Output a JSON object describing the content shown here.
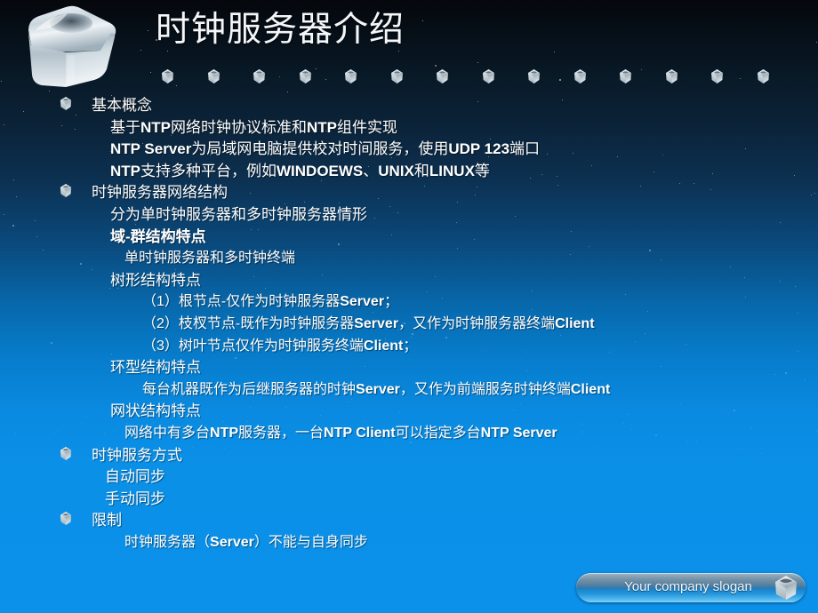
{
  "slide": {
    "title": "时钟服务器介绍",
    "logo_icon": "metallic-cube-icon",
    "decor_cube_count": 14
  },
  "footer": {
    "slogan": "Your company slogan",
    "cube_icon": "cube-icon"
  },
  "colors": {
    "bg_top": "#05070c",
    "bg_mid": "#0a4a7d",
    "bg_bottom": "#0b91ea",
    "text": "#ffffff",
    "pill_accent": "#2597dd"
  },
  "outline": [
    {
      "bullet": true,
      "level": 0,
      "segments": [
        {
          "t": "基本概念",
          "bold": false
        }
      ]
    },
    {
      "bullet": false,
      "level": 1,
      "segments": [
        {
          "t": "基于",
          "bold": false
        },
        {
          "t": "NTP",
          "bold": true
        },
        {
          "t": "网络时钟协议标准和",
          "bold": false
        },
        {
          "t": "NTP",
          "bold": true
        },
        {
          "t": "组件实现",
          "bold": false
        }
      ]
    },
    {
      "bullet": false,
      "level": 1,
      "segments": [
        {
          "t": "NTP Server",
          "bold": true
        },
        {
          "t": "为局域网电脑提供校对时间服务，使用",
          "bold": false
        },
        {
          "t": "UDP 123",
          "bold": true
        },
        {
          "t": "端口",
          "bold": false
        }
      ]
    },
    {
      "bullet": false,
      "level": 1,
      "segments": [
        {
          "t": "NTP",
          "bold": true
        },
        {
          "t": "支持多种平台，例如",
          "bold": false
        },
        {
          "t": "WINDOEWS",
          "bold": true
        },
        {
          "t": "、",
          "bold": false
        },
        {
          "t": "UNIX",
          "bold": true
        },
        {
          "t": "和",
          "bold": false
        },
        {
          "t": "LINUX",
          "bold": true
        },
        {
          "t": "等",
          "bold": false
        }
      ]
    },
    {
      "bullet": true,
      "level": 0,
      "segments": [
        {
          "t": "时钟服务器网络结构",
          "bold": false
        }
      ]
    },
    {
      "bullet": false,
      "level": 1,
      "segments": [
        {
          "t": "分为单时钟服务器和多时钟服务器情形",
          "bold": false
        }
      ]
    },
    {
      "bullet": false,
      "level": 1,
      "segments": [
        {
          "t": "域-群结构特点",
          "bold": true
        }
      ]
    },
    {
      "bullet": false,
      "level": 2,
      "segments": [
        {
          "t": "单时钟服务器和多时钟终端",
          "bold": false
        }
      ]
    },
    {
      "bullet": false,
      "level": 1,
      "segments": [
        {
          "t": "树形结构特点",
          "bold": false
        }
      ]
    },
    {
      "bullet": false,
      "level": 3,
      "segments": [
        {
          "t": "（1）根节点-仅作为时钟服务器",
          "bold": false
        },
        {
          "t": "Server",
          "bold": true
        },
        {
          "t": "；",
          "bold": false
        }
      ]
    },
    {
      "bullet": false,
      "level": 3,
      "segments": [
        {
          "t": "（2）枝杈节点-既作为时钟服务器",
          "bold": false
        },
        {
          "t": "Server",
          "bold": true
        },
        {
          "t": "，又作为时钟服务器终端",
          "bold": false
        },
        {
          "t": "Client",
          "bold": true
        }
      ]
    },
    {
      "bullet": false,
      "level": 3,
      "segments": [
        {
          "t": "（3）树叶节点仅作为时钟服务终端",
          "bold": false
        },
        {
          "t": "Client",
          "bold": true
        },
        {
          "t": "；",
          "bold": false
        }
      ]
    },
    {
      "bullet": false,
      "level": 1,
      "segments": [
        {
          "t": "环型结构特点",
          "bold": false
        }
      ]
    },
    {
      "bullet": false,
      "level": 3,
      "segments": [
        {
          "t": "每台机器既作为后继服务器的时钟",
          "bold": false
        },
        {
          "t": "Server",
          "bold": true
        },
        {
          "t": "，又作为前端服务时钟终端",
          "bold": false
        },
        {
          "t": "Client",
          "bold": true
        }
      ]
    },
    {
      "bullet": false,
      "level": 1,
      "segments": [
        {
          "t": "网状结构特点",
          "bold": false
        }
      ]
    },
    {
      "bullet": false,
      "level": 2,
      "segments": [
        {
          "t": "网络中有多台",
          "bold": false
        },
        {
          "t": "NTP",
          "bold": true
        },
        {
          "t": "服务器，一台",
          "bold": false
        },
        {
          "t": "NTP Client",
          "bold": true
        },
        {
          "t": "可以指定多台",
          "bold": false
        },
        {
          "t": "NTP Server",
          "bold": true
        }
      ]
    },
    {
      "bullet": true,
      "level": 0,
      "segments": [
        {
          "t": "时钟服务方式",
          "bold": false
        }
      ]
    },
    {
      "bullet": false,
      "level": 4,
      "segments": [
        {
          "t": "自动同步",
          "bold": false
        }
      ]
    },
    {
      "bullet": false,
      "level": 4,
      "segments": [
        {
          "t": "手动同步",
          "bold": false
        }
      ]
    },
    {
      "bullet": true,
      "level": 0,
      "segments": [
        {
          "t": "限制",
          "bold": false
        }
      ]
    },
    {
      "bullet": false,
      "level": 2,
      "segments": [
        {
          "t": "时钟服务器（",
          "bold": false
        },
        {
          "t": "Server",
          "bold": true
        },
        {
          "t": "）不能与自身同步",
          "bold": false
        }
      ]
    }
  ]
}
